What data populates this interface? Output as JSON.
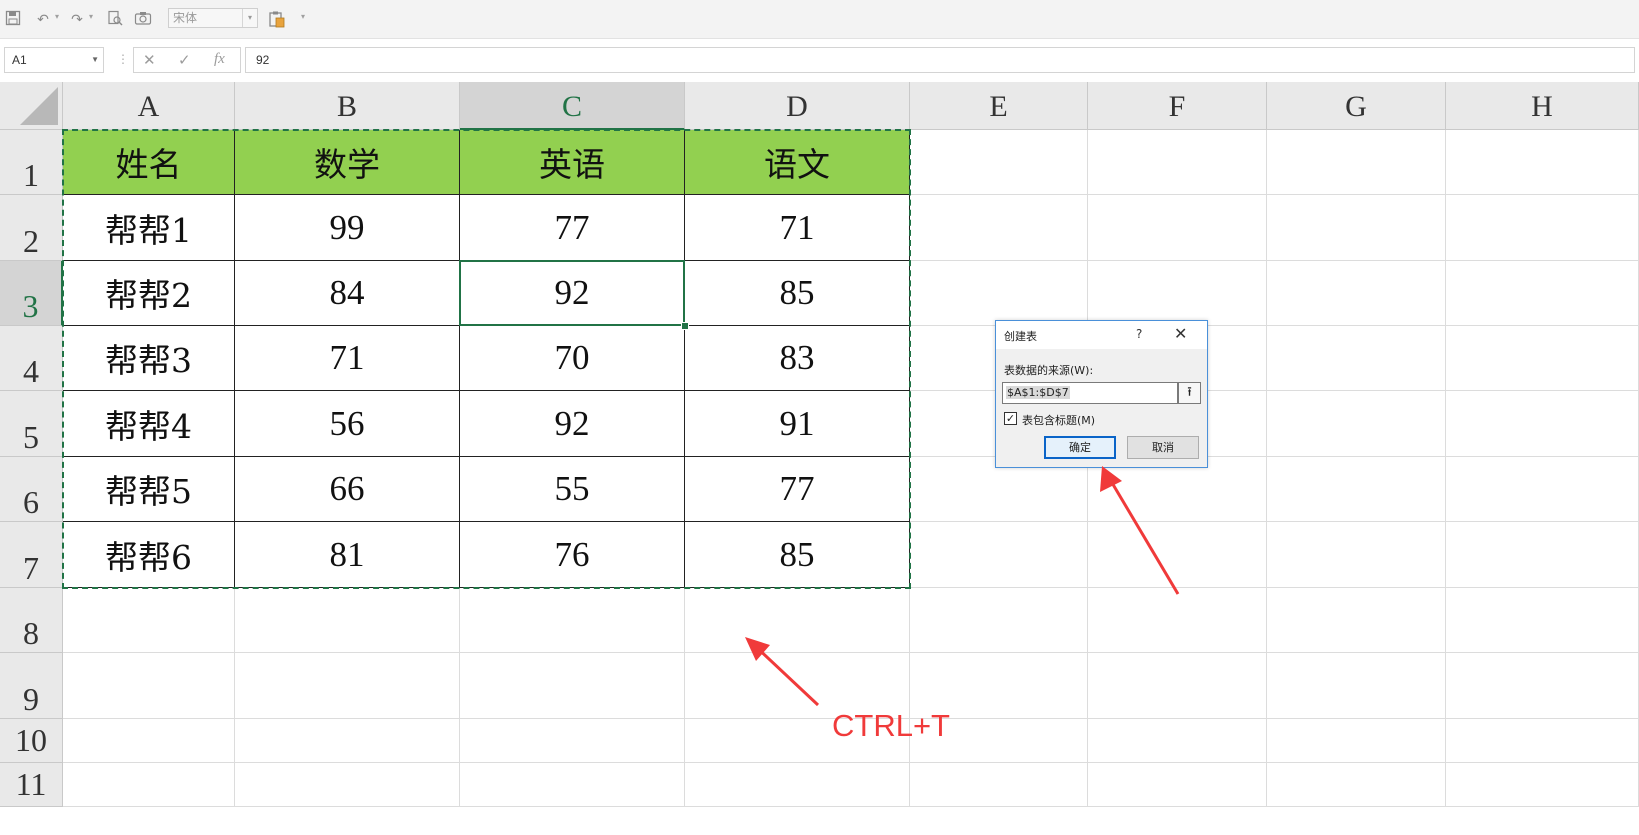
{
  "toolbar": {
    "font_name": "宋体",
    "icons": [
      "save-icon",
      "undo-icon",
      "redo-icon",
      "print-preview-icon",
      "camera-icon",
      "paste-icon",
      "customize-icon"
    ]
  },
  "formula_bar": {
    "name_box": "A1",
    "formula_value": "92",
    "fx_label": "fx"
  },
  "sheet": {
    "columns": [
      "A",
      "B",
      "C",
      "D",
      "E",
      "F",
      "G",
      "H"
    ],
    "rows": [
      "1",
      "2",
      "3",
      "4",
      "5",
      "6",
      "7",
      "8",
      "9",
      "10",
      "11"
    ],
    "selected_column": "C",
    "selected_row": "3",
    "table_header": [
      "姓名",
      "数学",
      "英语",
      "语文"
    ],
    "table_rows": [
      [
        "帮帮1",
        "99",
        "77",
        "71"
      ],
      [
        "帮帮2",
        "84",
        "92",
        "85"
      ],
      [
        "帮帮3",
        "71",
        "70",
        "83"
      ],
      [
        "帮帮4",
        "56",
        "92",
        "91"
      ],
      [
        "帮帮5",
        "66",
        "55",
        "77"
      ],
      [
        "帮帮6",
        "81",
        "76",
        "85"
      ]
    ],
    "header_fill_color": "#92d050",
    "selection_color": "#217346"
  },
  "dialog": {
    "title": "创建表",
    "help": "?",
    "close": "✕",
    "source_label": "表数据的来源(W):",
    "source_value": "$A$1:$D$7",
    "has_headers_label": "表包含标题(M)",
    "has_headers_checked": true,
    "ok_label": "确定",
    "cancel_label": "取消"
  },
  "annotation": {
    "shortcut": "CTRL+T",
    "arrow_color": "#f03a3a"
  }
}
